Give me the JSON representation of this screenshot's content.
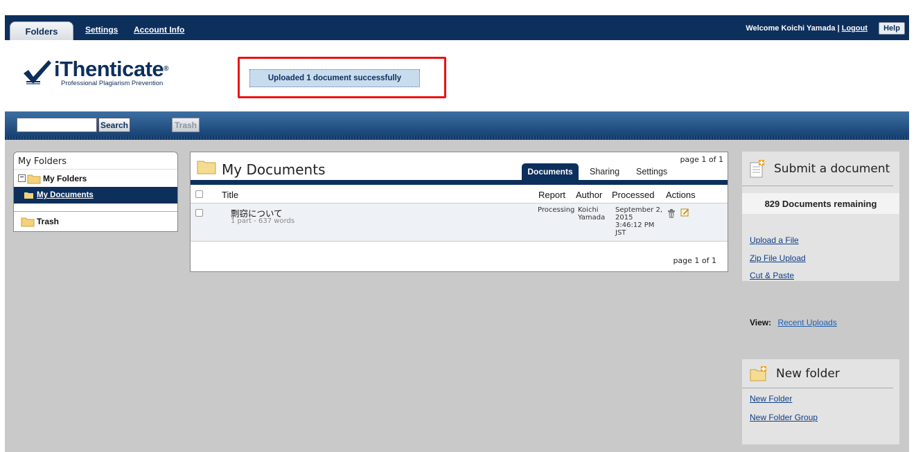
{
  "topnav": {
    "tabs": [
      "Folders",
      "Settings",
      "Account Info"
    ],
    "welcome": "Welcome Koichi Yamada",
    "separator": "|",
    "logout": "Logout",
    "help": "Help"
  },
  "brand": {
    "name": "iThenticate",
    "registered": "®",
    "tagline": "Professional Plagiarism Prevention"
  },
  "notice": "Uploaded 1 document successfully",
  "searchbar": {
    "search_value": "",
    "search_button": "Search",
    "trash_button": "Trash"
  },
  "sidebar": {
    "title": "My Folders",
    "group": "My Folders",
    "selected": "My Documents",
    "trash": "Trash"
  },
  "documents": {
    "title": "My Documents",
    "page_top": "page 1 of 1",
    "page_bottom": "page 1 of 1",
    "tabs": [
      "Documents",
      "Sharing",
      "Settings"
    ],
    "columns": [
      "Title",
      "Report",
      "Author",
      "Processed",
      "Actions"
    ],
    "rows": [
      {
        "title": "剽窃について",
        "meta": "1 part - 637 words",
        "report": "Processing",
        "author_1": "Koichi",
        "author_2": "Yamada",
        "processed_1": "September 2,",
        "processed_2": "2015",
        "processed_3": "3:46:12 PM",
        "processed_4": "JST"
      }
    ]
  },
  "submit": {
    "title": "Submit a document",
    "remaining": "829 Documents remaining",
    "links": [
      "Upload a File",
      "Zip File Upload",
      "Cut & Paste"
    ]
  },
  "view": {
    "label": "View:",
    "link": "Recent Uploads"
  },
  "newfolder": {
    "title": "New folder",
    "links": [
      "New Folder",
      "New Folder Group"
    ]
  },
  "colors": {
    "navy": "#0d2f5c",
    "highlight": "#ee1111",
    "link": "#0d3d86"
  },
  "icons": [
    "check-logo-icon",
    "folder-icon",
    "collapse-icon",
    "trash-icon",
    "edit-icon",
    "document-add-icon",
    "folder-add-icon"
  ]
}
